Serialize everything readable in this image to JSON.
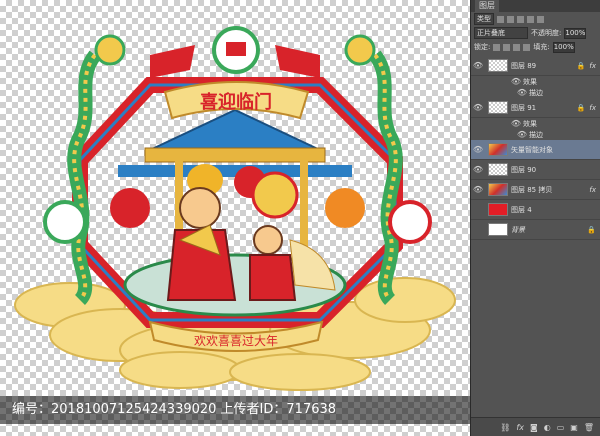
{
  "artwork": {
    "banner_text": "喜迎临门",
    "ribbon_text": "欢欢喜喜过大年",
    "colors": {
      "red": "#d8232a",
      "blue": "#2b7fc4",
      "gold": "#f2d57a",
      "green": "#3aa85a"
    }
  },
  "watermark": {
    "text": "编号：20181007125424339020 上传者ID：717638"
  },
  "panel": {
    "tab_label": "图层",
    "filter_select": "类型",
    "blend_mode": "正片叠底",
    "opacity_label": "不透明度:",
    "opacity_value": "100%",
    "lock_label": "锁定:",
    "fill_label": "填充:",
    "fill_value": "100%",
    "layers": [
      {
        "name": "图层 89",
        "thumb": "checker",
        "visible": true,
        "fx": true,
        "locked": true
      },
      {
        "name": "效果",
        "sub": true
      },
      {
        "name": "描边",
        "sub": true
      },
      {
        "name": "图层 91",
        "thumb": "checker",
        "visible": true,
        "fx": true,
        "locked": true
      },
      {
        "name": "效果",
        "sub": true
      },
      {
        "name": "描边",
        "sub": true
      },
      {
        "name": "矢量智能对象",
        "thumb": "img",
        "visible": true,
        "selected": true
      },
      {
        "name": "图层 90",
        "thumb": "checker",
        "visible": true
      },
      {
        "name": "图层 85 拷贝",
        "thumb": "img",
        "visible": true,
        "fx": true
      },
      {
        "name": "图层 4",
        "thumb": "red",
        "visible": false
      },
      {
        "name": "背景",
        "thumb": "white",
        "visible": false,
        "locked": true
      }
    ],
    "footer_icons": [
      "link-icon",
      "fx-icon",
      "mask-icon",
      "adjustment-icon",
      "group-icon",
      "new-layer-icon",
      "trash-icon"
    ]
  }
}
